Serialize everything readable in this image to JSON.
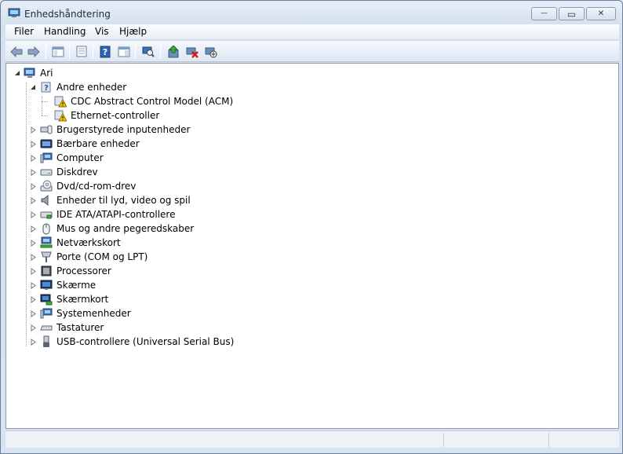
{
  "window": {
    "title": "Enhedshåndtering",
    "minimize_glyph": "—",
    "maximize_glyph": "▭",
    "close_glyph": "✕"
  },
  "menu": [
    "Filer",
    "Handling",
    "Vis",
    "Hjælp"
  ],
  "toolbar": {
    "buttons": [
      "back-icon",
      "forward-icon",
      "show-hide-console-tree-icon",
      "properties-icon",
      "help-icon",
      "action-pane-icon",
      "scan-hardware-icon",
      "update-driver-icon",
      "uninstall-icon",
      "disable-device-icon"
    ]
  },
  "tree": {
    "root": {
      "label": "Ari",
      "icon": "computer-icon",
      "expanded": true
    },
    "andre": {
      "label": "Andre enheder",
      "icon": "unknown-device-icon",
      "expanded": true,
      "children": [
        {
          "label": "CDC Abstract Control Model (ACM)",
          "icon": "warning-device-icon"
        },
        {
          "label": "Ethernet-controller",
          "icon": "warning-device-icon"
        }
      ]
    },
    "categories": [
      {
        "label": "Brugerstyrede inputenheder",
        "icon": "hid-icon"
      },
      {
        "label": "Bærbare enheder",
        "icon": "portable-device-icon"
      },
      {
        "label": "Computer",
        "icon": "computer-icon"
      },
      {
        "label": "Diskdrev",
        "icon": "disk-drive-icon"
      },
      {
        "label": "Dvd/cd-rom-drev",
        "icon": "dvd-drive-icon"
      },
      {
        "label": "Enheder til lyd, video og spil",
        "icon": "speaker-icon"
      },
      {
        "label": "IDE ATA/ATAPI-controllere",
        "icon": "ide-controller-icon"
      },
      {
        "label": "Mus og andre pegeredskaber",
        "icon": "mouse-icon"
      },
      {
        "label": "Netværkskort",
        "icon": "network-adapter-icon"
      },
      {
        "label": "Porte (COM og LPT)",
        "icon": "port-icon"
      },
      {
        "label": "Processorer",
        "icon": "processor-icon"
      },
      {
        "label": "Skærme",
        "icon": "monitor-icon"
      },
      {
        "label": "Skærmkort",
        "icon": "display-adapter-icon"
      },
      {
        "label": "Systemenheder",
        "icon": "system-device-icon"
      },
      {
        "label": "Tastaturer",
        "icon": "keyboard-icon"
      },
      {
        "label": "USB-controllere (Universal Serial Bus)",
        "icon": "usb-icon"
      }
    ]
  },
  "colors": {
    "window_frame": "#6a7f9a",
    "warning": "#f2c500",
    "title_text": "#1d2b3f"
  }
}
